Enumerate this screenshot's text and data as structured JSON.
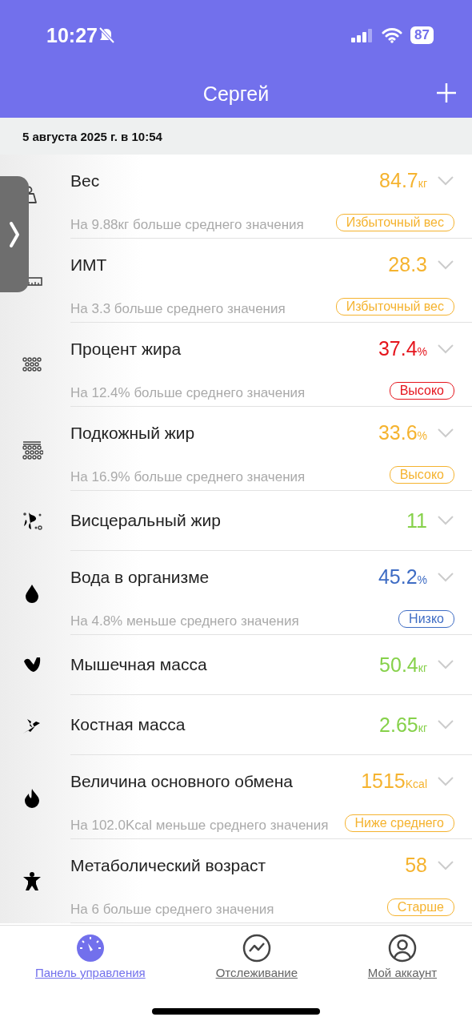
{
  "status_bar": {
    "time": "10:27",
    "battery": "87"
  },
  "header": {
    "title": "Сергей"
  },
  "date": "5 августа 2025 г. в 10:54",
  "metrics": [
    {
      "name": "Вес",
      "value": "84.7",
      "unit": "кг",
      "color": "#f5b32f",
      "note": "На 9.88кг больше среднего значения",
      "status": "Избыточный вес"
    },
    {
      "name": "ИМТ",
      "value": "28.3",
      "color": "#f5b32f",
      "note": "На 3.3 больше среднего значения",
      "status": "Избыточный вес"
    },
    {
      "name": "Процент жира",
      "value": "37.4",
      "unit": "%",
      "color": "#e5141c",
      "note": "На 12.4% больше среднего значения",
      "status": "Высоко"
    },
    {
      "name": "Подкожный жир",
      "value": "33.6",
      "unit": "%",
      "color": "#f5b32f",
      "note": "На 16.9% больше среднего значения",
      "status": "Высоко"
    },
    {
      "name": "Висцеральный жир",
      "value": "11",
      "color": "#86d14a"
    },
    {
      "name": "Вода в организме",
      "value": "45.2",
      "unit": "%",
      "color": "#3e6cc4",
      "note": "На 4.8% меньше среднего значения",
      "status": "Низко"
    },
    {
      "name": "Мышечная масса",
      "value": "50.4",
      "unit": "кг",
      "color": "#86d14a"
    },
    {
      "name": "Костная масса",
      "value": "2.65",
      "unit": "кг",
      "color": "#86d14a"
    },
    {
      "name": "Величина основного обмена",
      "value": "1515",
      "unit": "Kcal",
      "color": "#f5b32f",
      "note": "На 102.0Kcal меньше среднего значения",
      "status": "Ниже среднего"
    },
    {
      "name": "Метаболический возраст",
      "value": "58",
      "color": "#f5b32f",
      "note": "На 6 больше среднего значения",
      "status": "Старше"
    }
  ],
  "nav": [
    {
      "label": "Панель управления",
      "selected": true
    },
    {
      "label": "Отслеживание",
      "selected": false
    },
    {
      "label": "Мой аккаунт",
      "selected": false
    }
  ]
}
